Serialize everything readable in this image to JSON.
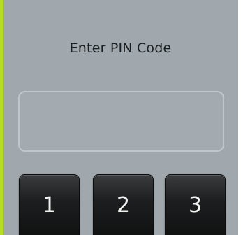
{
  "title": "Enter PIN Code",
  "pin_input": {
    "value": "",
    "placeholder": ""
  },
  "keypad": {
    "keys": [
      "1",
      "2",
      "3"
    ]
  },
  "colors": {
    "panel_background": "#a0a8ad",
    "accent_edge": "#b4dc28",
    "key_background": "#1a1b1c",
    "key_text": "#f2f2f2",
    "title_text": "#1a1d20"
  }
}
